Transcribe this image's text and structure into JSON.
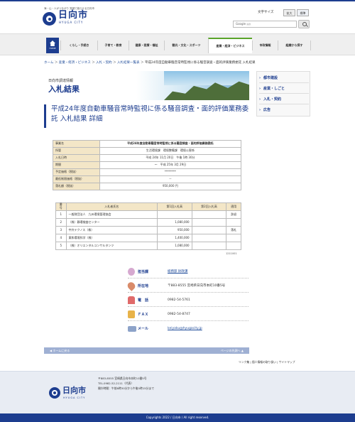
{
  "header": {
    "catchphrase": "海・山・人がつながり 笑顔で暮らせる日向市",
    "logo_text": "日向市",
    "logo_sub": "HYUGA CITY",
    "fontsize_label": "文字サイズ",
    "fontsize_large": "拡大",
    "fontsize_standard": "標準",
    "search_brand": "Google",
    "search_suffix": "提供"
  },
  "nav": {
    "home": "HOME",
    "items": [
      "くらし・手続き",
      "子育て・教育",
      "健康・医療・福祉",
      "観光・文化・スポーツ",
      "産業・経済・ビジネス",
      "市政情報",
      "組織から探す"
    ]
  },
  "breadcrumb": {
    "home": "ホーム",
    "sep": "＞",
    "c1": "産業・経済・ビジネス",
    "c2": "入札・契約",
    "c3": "入札結果一覧表",
    "current": "平成24年度自動車騒音常時監視に係る騒音調査・面的評価業務委託 入札結果"
  },
  "banner": {
    "small": "日向市調達情報",
    "title": "入札結果"
  },
  "page_title": "平成24年度自動車騒音常時監視に係る騒音調査・面的評価業務委託 入札結果 詳細",
  "sidebar": {
    "items": [
      "都市建設",
      "産業・しごと",
      "入札・契約",
      "広告"
    ]
  },
  "info_table": {
    "rows": [
      {
        "label": "事業名",
        "value": "平成24年度自動車騒音常時監視に係る騒音調査・面的評価業務委託"
      },
      {
        "label": "所管",
        "value": "生活環境課　環境整備課　環境公害係"
      },
      {
        "label": "入札日時",
        "value": "平成 24年 11月 20日　午後 1時 30分"
      },
      {
        "label": "期間",
        "value": "～　平成 25年 3月 29日"
      },
      {
        "label": "予定価格（税抜）",
        "value": "********"
      },
      {
        "label": "最低制限価格（税抜）",
        "value": "－"
      },
      {
        "label": "落札額（税抜）",
        "value": "950,000 円"
      }
    ]
  },
  "bid_table": {
    "headers": [
      "番号",
      "入札者氏名",
      "第1回入札高",
      "第2回入札高",
      "適用"
    ],
    "rows": [
      {
        "no": "1",
        "name": "一般財団法人　九州環境管理協会",
        "r1": "",
        "r2": "",
        "note": "辞退"
      },
      {
        "no": "2",
        "name": "（株）静環検査センター",
        "r1": "1,080,000",
        "r2": "",
        "note": ""
      },
      {
        "no": "3",
        "name": "中外テクノス（株）",
        "r1": "950,000",
        "r2": "",
        "note": "落札"
      },
      {
        "no": "4",
        "name": "東和環境科学（株）",
        "r1": "1,400,000",
        "r2": "",
        "note": ""
      },
      {
        "no": "5",
        "name": "（株）オリエンタルコンサルタンツ",
        "r1": "1,080,000",
        "r2": "",
        "note": ""
      }
    ]
  },
  "record_code": "1211001",
  "contact": {
    "dept_label": "担当課",
    "dept_value": "総務部 財政課",
    "addr_label": "所在地",
    "addr_value": "〒883-8555 宮崎県日向市本町10番5号",
    "tel_label": "電　話",
    "tel_value": "0982-54-5761",
    "fax_label": "ＦＡＸ",
    "fax_value": "0982-54-8747",
    "mail_label": "メール",
    "mail_value": "keiyaku@hyugacity.jp"
  },
  "pager": {
    "home": "ホームに戻る",
    "top": "ページの先頭へ"
  },
  "footer_links": "リンク集 | 個人情報の取り扱い | サイトマップ",
  "footer": {
    "name": "日向市",
    "sub": "HYUGA CITY",
    "address": "〒883-8555 宮崎県日向市本町10番5号",
    "tel": "TEL.0982-52-2111（代表）",
    "hours": "開庁時間：午前8時30分から午後5時15分まで"
  },
  "copyright": "Copyrights 2022 / 日向市 / All right reserved."
}
